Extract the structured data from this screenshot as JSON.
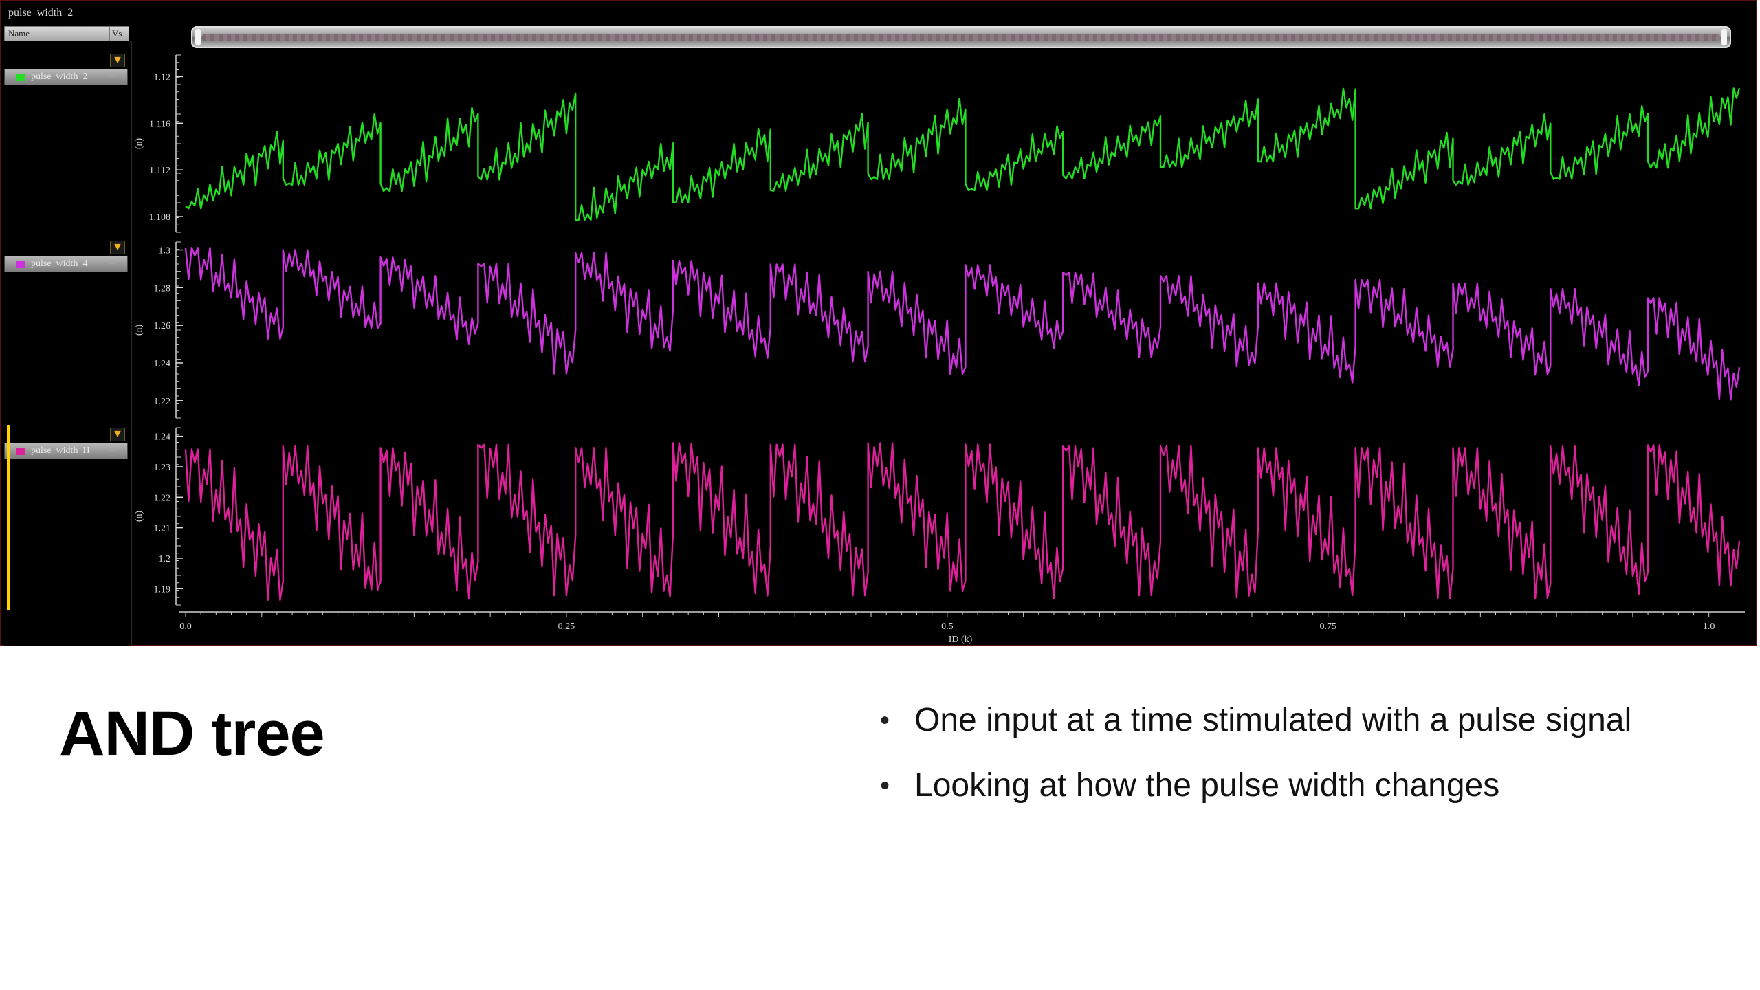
{
  "window": {
    "title": "pulse_width_2"
  },
  "name_panel": {
    "header_name": "Name",
    "header_vs": "Vs",
    "signals": [
      {
        "label": "pulse_width_2",
        "color": "#22dd22",
        "menu": "··"
      },
      {
        "label": "pulse_width_4",
        "color": "#cc33dd",
        "menu": "··"
      },
      {
        "label": "pulse_width_H",
        "color": "#dd2299",
        "menu": "··"
      }
    ],
    "filter_icon": "funnel-icon"
  },
  "plots": [
    {
      "unit": "(n)",
      "y_ticks": [
        "1.12",
        "1.116",
        "1.112",
        "1.108"
      ]
    },
    {
      "unit": "(n)",
      "y_ticks": [
        "1.3",
        "1.28",
        "1.26",
        "1.24",
        "1.22"
      ]
    },
    {
      "unit": "(n)",
      "y_ticks": [
        "1.24",
        "1.23",
        "1.22",
        "1.21",
        "1.2",
        "1.19"
      ]
    }
  ],
  "x_axis": {
    "label": "ID (k)",
    "ticks": [
      "0.0",
      "0.25",
      "0.5",
      "0.75",
      "1.0"
    ]
  },
  "slide": {
    "title": "AND tree",
    "bullets": [
      "One input at a time stimulated with a pulse signal",
      "Looking at how the pulse width changes"
    ]
  },
  "chart_data": [
    {
      "type": "line",
      "series": [
        {
          "name": "pulse_width_2",
          "color": "#22dd22"
        }
      ],
      "y_ticks": [
        1.108,
        1.112,
        1.116,
        1.12
      ],
      "ylim": [
        1.107,
        1.1215
      ],
      "xlim": [
        0,
        1.02
      ],
      "x_ticks": [
        0,
        0.25,
        0.5,
        0.75,
        1.0
      ],
      "xlabel": "ID (k)",
      "ylabel": "(n)",
      "pattern": "sawtooth rising within segments",
      "segments": [
        {
          "x": [
            0.0,
            0.064
          ],
          "y": [
            1.109,
            1.115
          ]
        },
        {
          "x": [
            0.064,
            0.128
          ],
          "y": [
            1.111,
            1.1165
          ]
        },
        {
          "x": [
            0.128,
            0.192
          ],
          "y": [
            1.1105,
            1.117
          ]
        },
        {
          "x": [
            0.192,
            0.256
          ],
          "y": [
            1.1115,
            1.1183
          ]
        },
        {
          "x": [
            0.256,
            0.32
          ],
          "y": [
            1.108,
            1.114
          ]
        },
        {
          "x": [
            0.32,
            0.384
          ],
          "y": [
            1.1095,
            1.1155
          ]
        },
        {
          "x": [
            0.384,
            0.448
          ],
          "y": [
            1.1105,
            1.1165
          ]
        },
        {
          "x": [
            0.448,
            0.512
          ],
          "y": [
            1.1115,
            1.1178
          ]
        },
        {
          "x": [
            0.512,
            0.576
          ],
          "y": [
            1.1105,
            1.1155
          ]
        },
        {
          "x": [
            0.576,
            0.64
          ],
          "y": [
            1.1115,
            1.1165
          ]
        },
        {
          "x": [
            0.64,
            0.704
          ],
          "y": [
            1.1125,
            1.1178
          ]
        },
        {
          "x": [
            0.704,
            0.768
          ],
          "y": [
            1.113,
            1.1188
          ]
        },
        {
          "x": [
            0.768,
            0.832
          ],
          "y": [
            1.109,
            1.115
          ]
        },
        {
          "x": [
            0.832,
            0.896
          ],
          "y": [
            1.111,
            1.1165
          ]
        },
        {
          "x": [
            0.896,
            0.96
          ],
          "y": [
            1.1115,
            1.1172
          ]
        },
        {
          "x": [
            0.96,
            1.02
          ],
          "y": [
            1.1125,
            1.119
          ]
        }
      ]
    },
    {
      "type": "line",
      "series": [
        {
          "name": "pulse_width_4",
          "color": "#cc33dd"
        }
      ],
      "y_ticks": [
        1.22,
        1.24,
        1.26,
        1.28,
        1.3
      ],
      "ylim": [
        1.213,
        1.302
      ],
      "xlim": [
        0,
        1.02
      ],
      "x_ticks": [
        0,
        0.25,
        0.5,
        0.75,
        1.0
      ],
      "xlabel": "ID (k)",
      "ylabel": "(n)",
      "pattern": "sawtooth falling within segments",
      "segments": [
        {
          "x": [
            0.0,
            0.064
          ],
          "y": [
            1.299,
            1.255
          ]
        },
        {
          "x": [
            0.064,
            0.128
          ],
          "y": [
            1.298,
            1.258
          ]
        },
        {
          "x": [
            0.128,
            0.192
          ],
          "y": [
            1.294,
            1.252
          ]
        },
        {
          "x": [
            0.192,
            0.256
          ],
          "y": [
            1.29,
            1.237
          ]
        },
        {
          "x": [
            0.256,
            0.32
          ],
          "y": [
            1.296,
            1.248
          ]
        },
        {
          "x": [
            0.32,
            0.384
          ],
          "y": [
            1.292,
            1.245
          ]
        },
        {
          "x": [
            0.384,
            0.448
          ],
          "y": [
            1.29,
            1.243
          ]
        },
        {
          "x": [
            0.448,
            0.512
          ],
          "y": [
            1.286,
            1.235
          ]
        },
        {
          "x": [
            0.512,
            0.576
          ],
          "y": [
            1.29,
            1.25
          ]
        },
        {
          "x": [
            0.576,
            0.64
          ],
          "y": [
            1.286,
            1.245
          ]
        },
        {
          "x": [
            0.64,
            0.704
          ],
          "y": [
            1.284,
            1.24
          ]
        },
        {
          "x": [
            0.704,
            0.768
          ],
          "y": [
            1.28,
            1.232
          ]
        },
        {
          "x": [
            0.768,
            0.832
          ],
          "y": [
            1.282,
            1.24
          ]
        },
        {
          "x": [
            0.832,
            0.896
          ],
          "y": [
            1.28,
            1.236
          ]
        },
        {
          "x": [
            0.896,
            0.96
          ],
          "y": [
            1.277,
            1.23
          ]
        },
        {
          "x": [
            0.96,
            1.02
          ],
          "y": [
            1.272,
            1.223
          ]
        }
      ]
    },
    {
      "type": "line",
      "series": [
        {
          "name": "pulse_width_H",
          "color": "#dd2299"
        }
      ],
      "y_ticks": [
        1.19,
        1.2,
        1.21,
        1.22,
        1.23,
        1.24
      ],
      "ylim": [
        1.186,
        1.2415
      ],
      "xlim": [
        0,
        1.02
      ],
      "x_ticks": [
        0,
        0.25,
        0.5,
        0.75,
        1.0
      ],
      "xlabel": "ID (k)",
      "ylabel": "(n)",
      "pattern": "sawtooth falling within segments",
      "segments": [
        {
          "x": [
            0.0,
            0.064
          ],
          "y": [
            1.2335,
            1.1885
          ]
        },
        {
          "x": [
            0.064,
            0.128
          ],
          "y": [
            1.2345,
            1.189
          ]
        },
        {
          "x": [
            0.128,
            0.192
          ],
          "y": [
            1.234,
            1.189
          ]
        },
        {
          "x": [
            0.192,
            0.256
          ],
          "y": [
            1.235,
            1.19
          ]
        },
        {
          "x": [
            0.256,
            0.32
          ],
          "y": [
            1.234,
            1.189
          ]
        },
        {
          "x": [
            0.32,
            0.384
          ],
          "y": [
            1.2355,
            1.19
          ]
        },
        {
          "x": [
            0.384,
            0.448
          ],
          "y": [
            1.235,
            1.19
          ]
        },
        {
          "x": [
            0.448,
            0.512
          ],
          "y": [
            1.2355,
            1.19
          ]
        },
        {
          "x": [
            0.512,
            0.576
          ],
          "y": [
            1.235,
            1.189
          ]
        },
        {
          "x": [
            0.576,
            0.64
          ],
          "y": [
            1.2345,
            1.19
          ]
        },
        {
          "x": [
            0.64,
            0.704
          ],
          "y": [
            1.2345,
            1.189
          ]
        },
        {
          "x": [
            0.704,
            0.768
          ],
          "y": [
            1.234,
            1.19
          ]
        },
        {
          "x": [
            0.768,
            0.832
          ],
          "y": [
            1.234,
            1.189
          ]
        },
        {
          "x": [
            0.832,
            0.896
          ],
          "y": [
            1.234,
            1.189
          ]
        },
        {
          "x": [
            0.896,
            0.96
          ],
          "y": [
            1.2345,
            1.19
          ]
        },
        {
          "x": [
            0.96,
            1.02
          ],
          "y": [
            1.235,
            1.193
          ]
        }
      ]
    }
  ]
}
